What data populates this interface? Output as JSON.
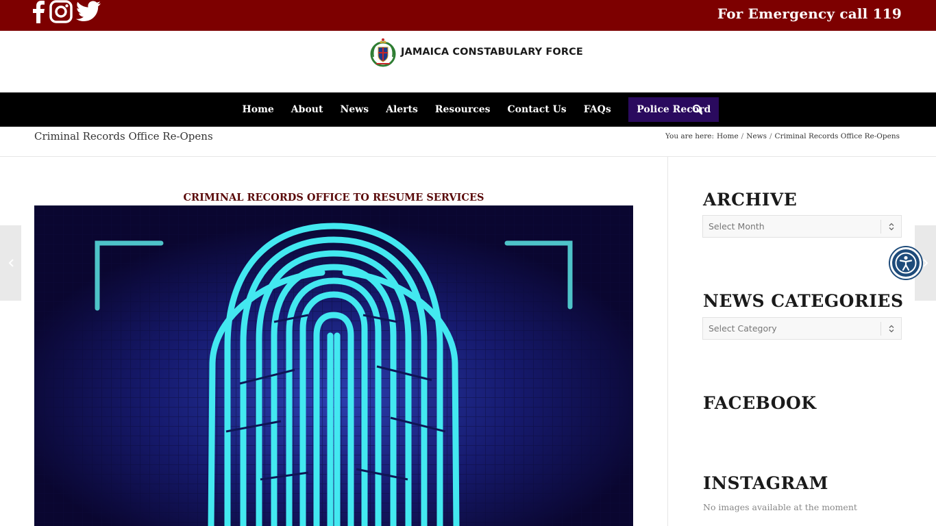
{
  "topbar": {
    "emergency_text": "For Emergency call 119",
    "bg_color": "#7d0000",
    "social_icons": [
      "facebook-icon",
      "instagram-icon",
      "twitter-icon"
    ]
  },
  "logo": {
    "text": "JAMAICA CONSTABULARY FORCE",
    "icon": "crest-icon"
  },
  "nav": {
    "items": [
      {
        "label": "Home"
      },
      {
        "label": "About"
      },
      {
        "label": "News"
      },
      {
        "label": "Alerts"
      },
      {
        "label": "Resources"
      },
      {
        "label": "Contact Us"
      },
      {
        "label": "FAQs"
      }
    ],
    "highlight_label": "Police Record",
    "highlight_color": "#2a0a5e",
    "search_icon": "search-icon"
  },
  "titlebar": {
    "page_title": "Criminal Records Office Re-Opens",
    "breadcrumb_prefix": "You are here:",
    "breadcrumb": [
      "Home",
      "News",
      "Criminal Records Office Re-Opens"
    ]
  },
  "content": {
    "headline": "CRIMINAL RECORDS OFFICE TO RESUME SERVICES",
    "headline_color": "#5a0a0a"
  },
  "sidebar": {
    "archive_title": "ARCHIVE",
    "archive_select": "Select Month",
    "categories_title": "NEWS CATEGORIES",
    "categories_select": "Select Category",
    "facebook_title": "FACEBOOK",
    "instagram_title": "INSTAGRAM",
    "instagram_empty": "No images available at the moment"
  }
}
